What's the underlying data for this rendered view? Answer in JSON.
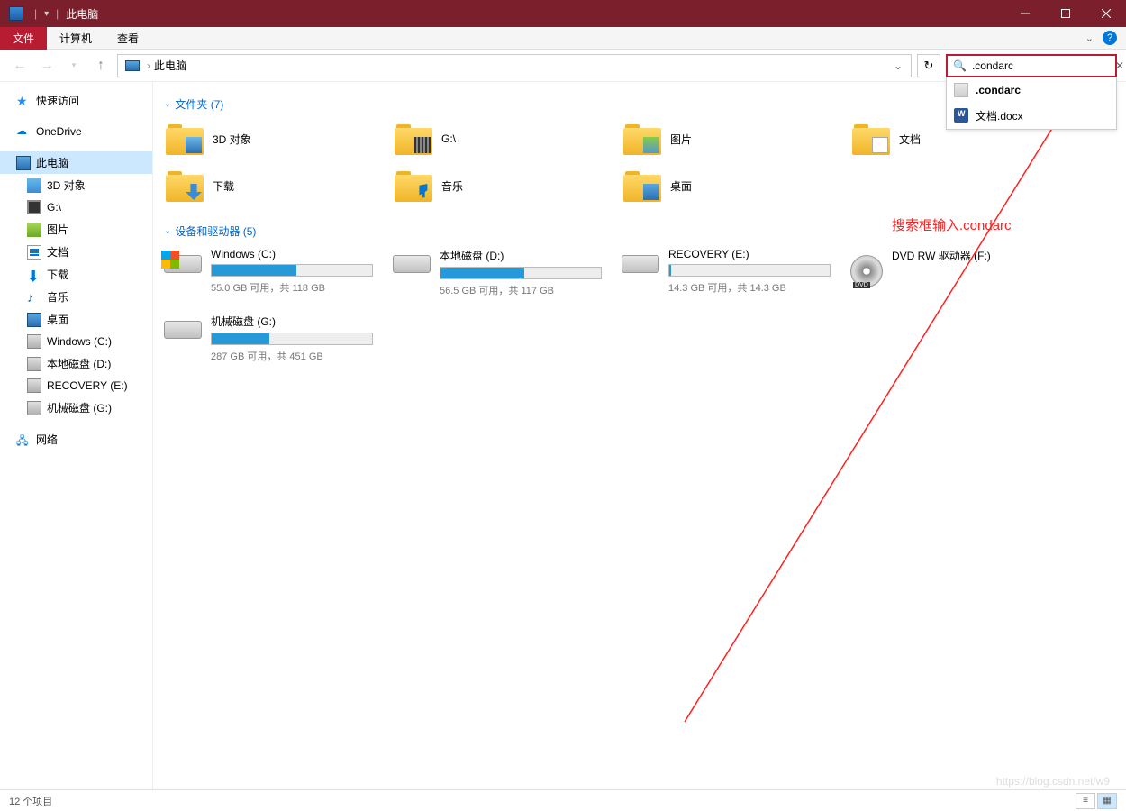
{
  "window": {
    "title": "此电脑"
  },
  "ribbon": {
    "file": "文件",
    "computer": "计算机",
    "view": "查看"
  },
  "breadcrumb": {
    "location": "此电脑"
  },
  "search": {
    "value": ".condarc",
    "suggestions": [
      {
        "label": ".condarc",
        "icon": "file"
      },
      {
        "label": "文档.docx",
        "icon": "word"
      }
    ]
  },
  "sidebar": {
    "quick_access": "快速访问",
    "onedrive": "OneDrive",
    "this_pc": "此电脑",
    "items": [
      {
        "label": "3D 对象",
        "icon": "obj3d"
      },
      {
        "label": "G:\\",
        "icon": "film"
      },
      {
        "label": "图片",
        "icon": "pic"
      },
      {
        "label": "文档",
        "icon": "doc"
      },
      {
        "label": "下载",
        "icon": "download"
      },
      {
        "label": "音乐",
        "icon": "music"
      },
      {
        "label": "桌面",
        "icon": "desk"
      },
      {
        "label": "Windows (C:)",
        "icon": "drive"
      },
      {
        "label": "本地磁盘 (D:)",
        "icon": "drive"
      },
      {
        "label": "RECOVERY (E:)",
        "icon": "drive"
      },
      {
        "label": "机械磁盘 (G:)",
        "icon": "drive"
      }
    ],
    "network": "网络"
  },
  "sections": {
    "folders_header": "文件夹 (7)",
    "drives_header": "设备和驱动器 (5)"
  },
  "folders": [
    {
      "label": "3D 对象",
      "overlay": "cube"
    },
    {
      "label": "G:\\",
      "overlay": "filmov"
    },
    {
      "label": "图片",
      "overlay": "picov"
    },
    {
      "label": "文档",
      "overlay": "docov"
    },
    {
      "label": "下载",
      "overlay": "arrow-down"
    },
    {
      "label": "音乐",
      "overlay": "noteov"
    },
    {
      "label": "桌面",
      "overlay": "deskov"
    }
  ],
  "drives": [
    {
      "name": "Windows (C:)",
      "stats": "55.0 GB 可用，共 118 GB",
      "fill": 53,
      "icon": "winlogo",
      "bar": true
    },
    {
      "name": "本地磁盘 (D:)",
      "stats": "56.5 GB 可用，共 117 GB",
      "fill": 52,
      "icon": "hdd",
      "bar": true
    },
    {
      "name": "RECOVERY (E:)",
      "stats": "14.3 GB 可用，共 14.3 GB",
      "fill": 1,
      "icon": "hdd",
      "bar": true
    },
    {
      "name": "DVD RW 驱动器 (F:)",
      "stats": "",
      "fill": 0,
      "icon": "dvd",
      "bar": false
    },
    {
      "name": "机械磁盘 (G:)",
      "stats": "287 GB 可用，共 451 GB",
      "fill": 36,
      "icon": "hdd",
      "bar": true
    }
  ],
  "annotation": {
    "text": "搜索框输入.condarc"
  },
  "status": {
    "count": "12 个项目"
  },
  "watermark": "https://blog.csdn.net/w9"
}
